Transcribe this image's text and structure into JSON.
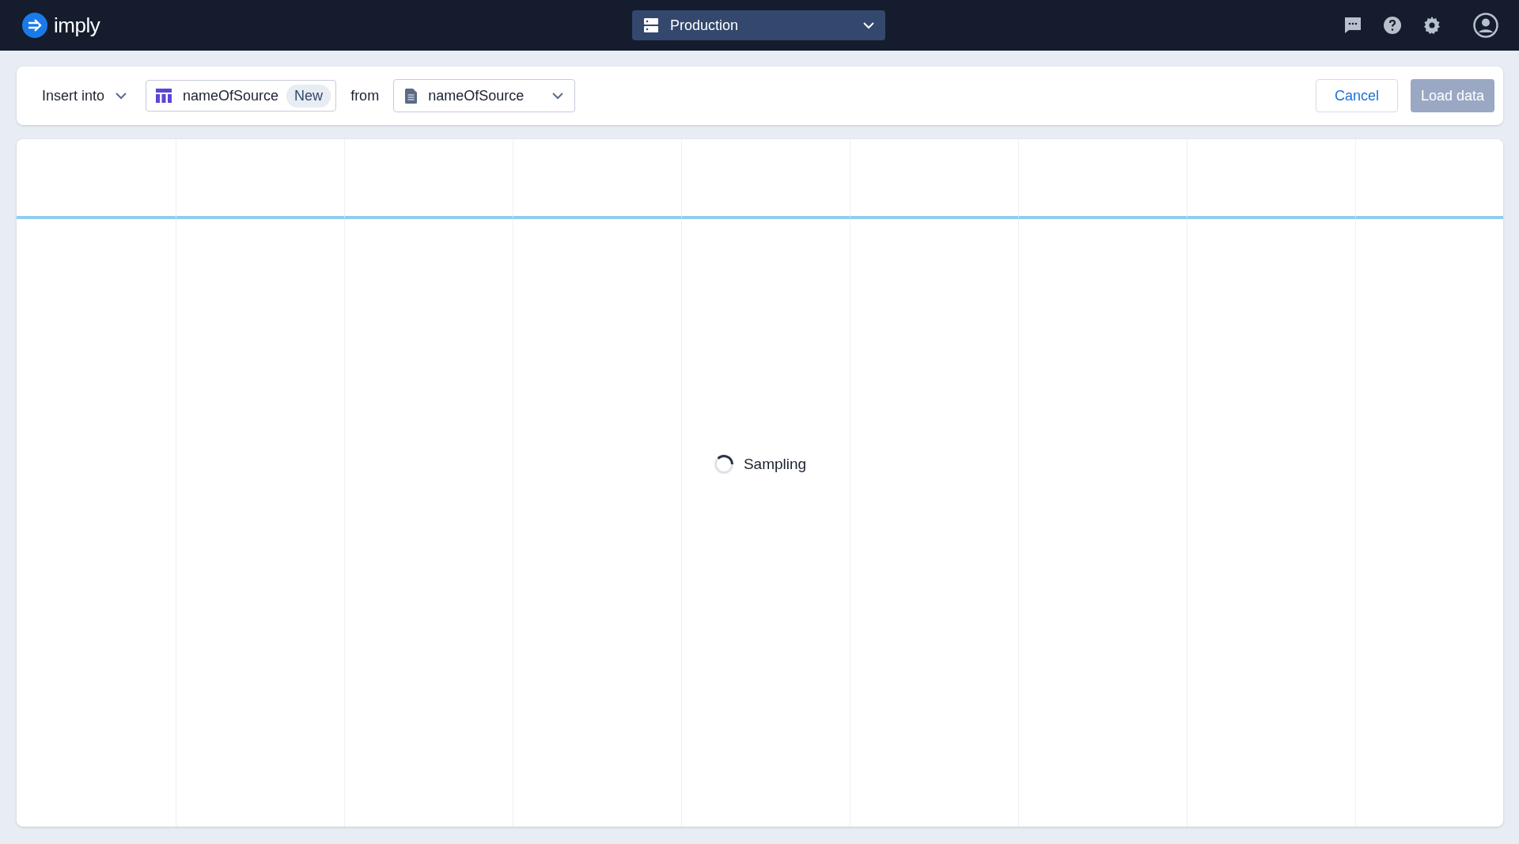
{
  "header": {
    "logo_text": "imply",
    "environment": "Production"
  },
  "toolbar": {
    "mode": "Insert into",
    "table": {
      "name": "nameOfSource",
      "badge": "New"
    },
    "from_label": "from",
    "source": "nameOfSource",
    "buttons": [
      {
        "label": "Cancel",
        "kind": "secondary",
        "disabled": false
      },
      {
        "label": "Load data",
        "kind": "primary",
        "disabled": true
      }
    ]
  },
  "preview": {
    "status": "Sampling"
  }
}
